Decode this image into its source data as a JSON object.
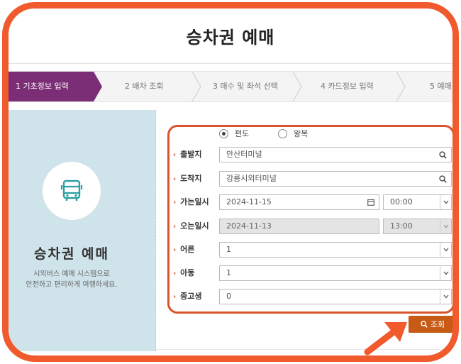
{
  "page": {
    "title": "승차권 예매"
  },
  "steps": [
    {
      "label": "1 기초정보 입력",
      "active": true
    },
    {
      "label": "2 배차 조회",
      "active": false
    },
    {
      "label": "3 매수 및 좌석 선택",
      "active": false
    },
    {
      "label": "4 카드정보 입력",
      "active": false
    },
    {
      "label": "5 예매",
      "active": false
    }
  ],
  "panel": {
    "title": "승차권 예매",
    "desc_line1": "시외버스 예매 시스템으로",
    "desc_line2": "안전하고 편리하게 여행하세요.",
    "icon": "bus-icon"
  },
  "trip_type": {
    "one_way": "편도",
    "round_trip": "왕복",
    "selected": "편도"
  },
  "form": {
    "departure": {
      "label": "출발지",
      "value": "안산터미널"
    },
    "arrival": {
      "label": "도착지",
      "value": "강릉시외터미널"
    },
    "go_date": {
      "label": "가는일시",
      "date": "2024-11-15",
      "time": "00:00"
    },
    "return_date": {
      "label": "오는일시",
      "date": "2024-11-13",
      "time": "13:00"
    },
    "adult": {
      "label": "어른",
      "value": "1"
    },
    "child": {
      "label": "아동",
      "value": "1"
    },
    "student": {
      "label": "중고생",
      "value": "0"
    }
  },
  "search_button": {
    "label": "조회"
  },
  "colors": {
    "frame": "#f05a2d",
    "accent": "#7b2d75",
    "button": "#c75a14",
    "panel_bg": "#cfe3ea"
  }
}
